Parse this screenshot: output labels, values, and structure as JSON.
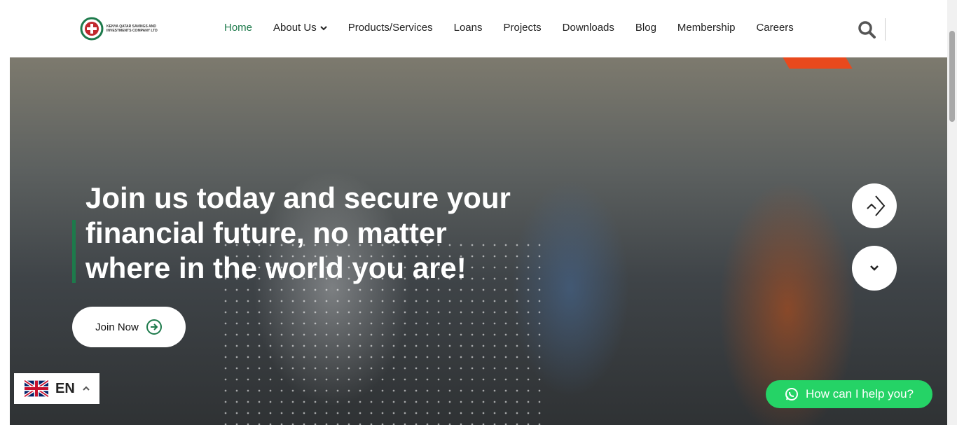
{
  "logo": {
    "text": "Kenya Qatar Savings and Investments Company Ltd"
  },
  "nav": {
    "home": "Home",
    "about": "About Us",
    "products": "Products/Services",
    "loans": "Loans",
    "projects": "Projects",
    "downloads": "Downloads",
    "blog": "Blog",
    "membership": "Membership",
    "careers": "Careers"
  },
  "hero": {
    "title": "Join us today and secure your financial future, no matter where in the world you are!",
    "cta_label": "Join Now"
  },
  "language": {
    "code": "EN"
  },
  "whatsapp": {
    "label": "How can I help you?"
  },
  "colors": {
    "accent": "#1d7a4b",
    "whatsapp": "#25d366",
    "orange": "#e8491d"
  },
  "icons": [
    "search-icon",
    "chevron-down-icon",
    "arrow-right-circle-icon",
    "chevron-up-icon",
    "uk-flag-icon",
    "whatsapp-icon"
  ]
}
